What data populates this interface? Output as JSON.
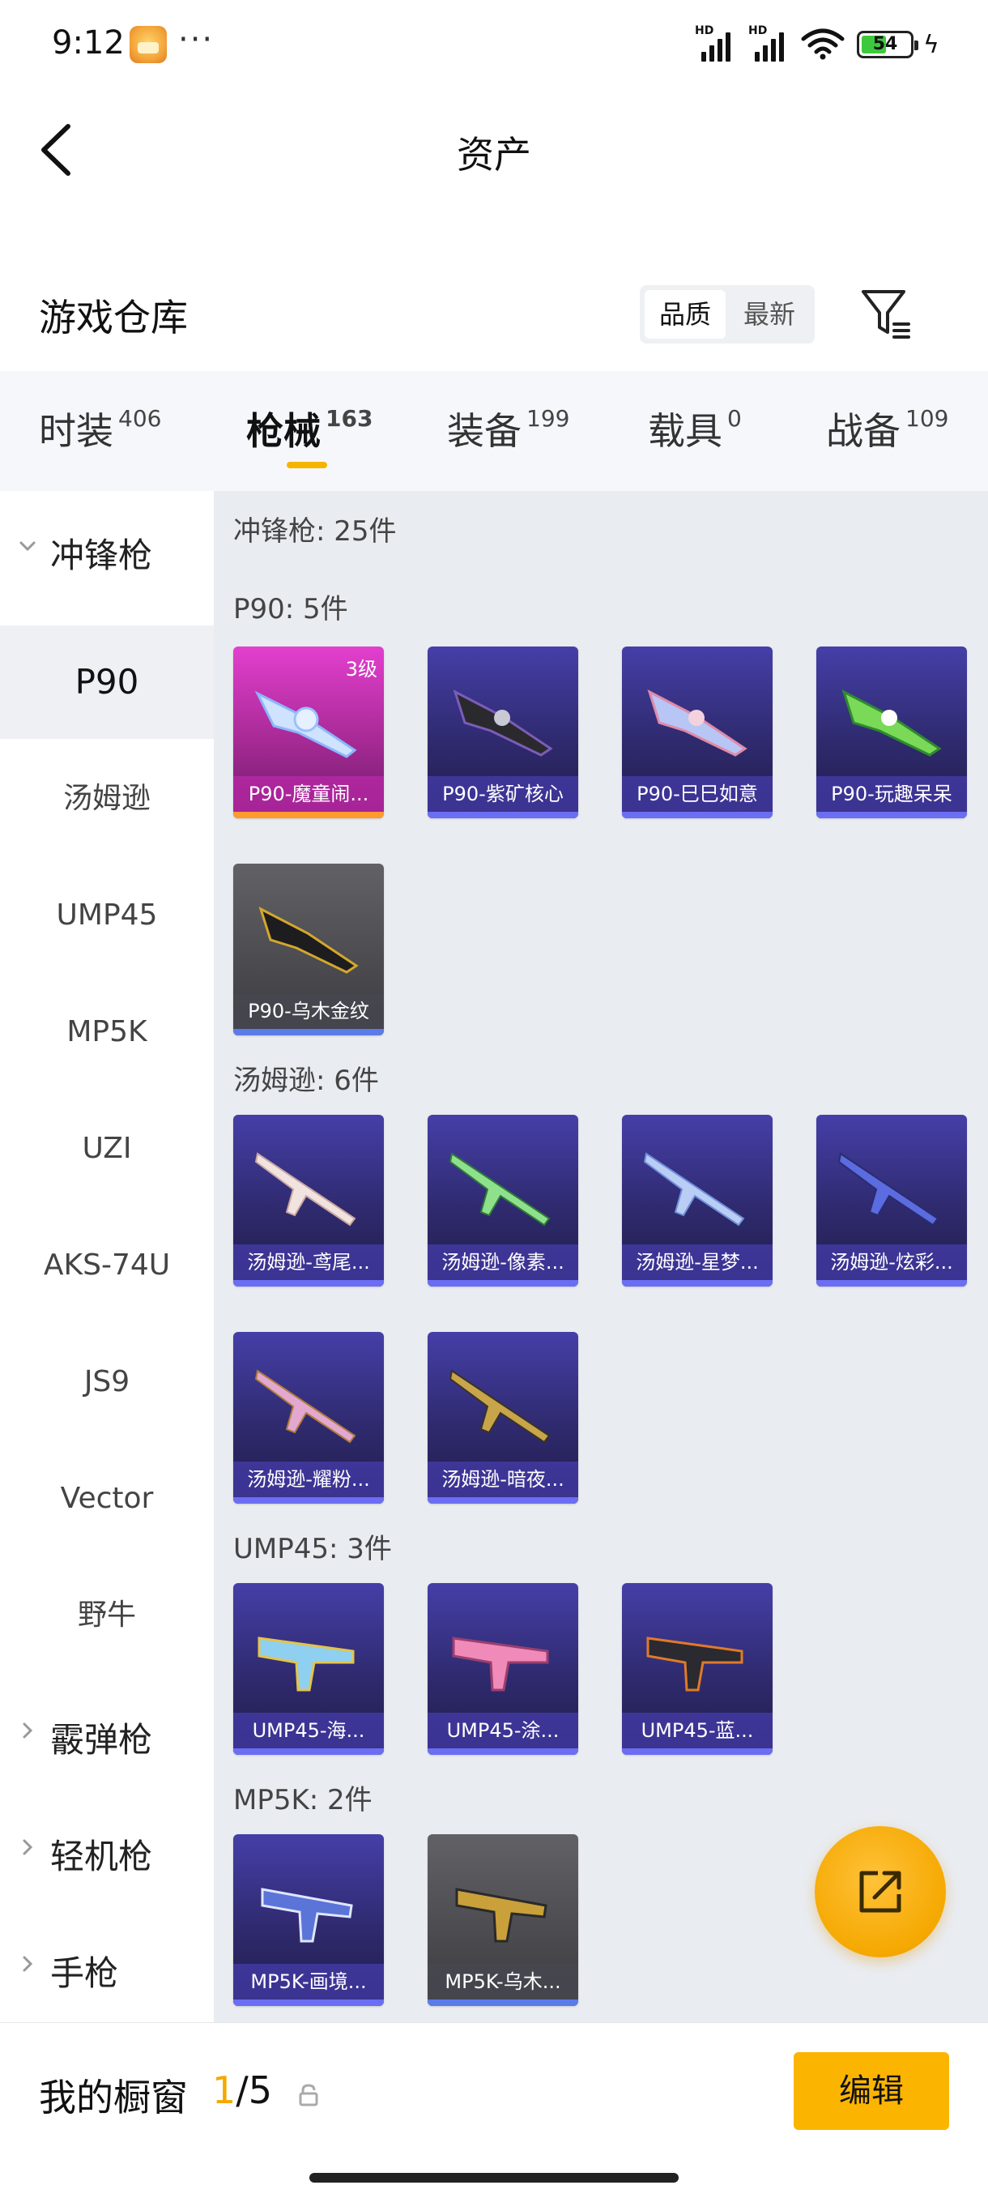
{
  "status_bar": {
    "time": "9:12",
    "dots": "···",
    "battery": "54",
    "hd1": "HD",
    "hd2": "HD"
  },
  "header": {
    "title": "资产"
  },
  "section": {
    "title": "游戏仓库",
    "sort_options": [
      "品质",
      "最新"
    ]
  },
  "tabs": [
    {
      "label": "时装",
      "count": "406"
    },
    {
      "label": "枪械",
      "count": "163"
    },
    {
      "label": "装备",
      "count": "199"
    },
    {
      "label": "载具",
      "count": "0"
    },
    {
      "label": "战备",
      "count": "109"
    }
  ],
  "sidebar": {
    "groups": [
      {
        "label": "冲锋枪",
        "expanded": true
      },
      {
        "label": "霰弹枪",
        "expanded": false
      },
      {
        "label": "轻机枪",
        "expanded": false
      },
      {
        "label": "手枪",
        "expanded": false
      }
    ],
    "items": [
      "P90",
      "汤姆逊",
      "UMP45",
      "MP5K",
      "UZI",
      "AKS-74U",
      "JS9",
      "Vector",
      "野牛"
    ],
    "active_item": "P90"
  },
  "content": {
    "category_title": "冲锋枪: 25件",
    "groups": [
      {
        "title": "P90: 5件",
        "items": [
          {
            "name": "P90-魔童闹...",
            "level": "3级",
            "rarity": "gold"
          },
          {
            "name": "P90-紫矿核心",
            "rarity": "purple"
          },
          {
            "name": "P90-巳巳如意",
            "rarity": "purple"
          },
          {
            "name": "P90-玩趣呆呆",
            "rarity": "purple"
          },
          {
            "name": "P90-乌木金纹",
            "rarity": "gray"
          }
        ]
      },
      {
        "title": "汤姆逊: 6件",
        "items": [
          {
            "name": "汤姆逊-鸢尾...",
            "rarity": "purple"
          },
          {
            "name": "汤姆逊-像素...",
            "rarity": "purple"
          },
          {
            "name": "汤姆逊-星梦...",
            "rarity": "purple"
          },
          {
            "name": "汤姆逊-炫彩...",
            "rarity": "purple"
          },
          {
            "name": "汤姆逊-耀粉...",
            "rarity": "purple"
          },
          {
            "name": "汤姆逊-暗夜...",
            "rarity": "purple"
          }
        ]
      },
      {
        "title": "UMP45: 3件",
        "items": [
          {
            "name": "UMP45-海...",
            "rarity": "purple"
          },
          {
            "name": "UMP45-涂...",
            "rarity": "purple"
          },
          {
            "name": "UMP45-蓝...",
            "rarity": "purple"
          }
        ]
      },
      {
        "title": "MP5K: 2件",
        "items": [
          {
            "name": "MP5K-画境...",
            "rarity": "purple"
          },
          {
            "name": "MP5K-乌木...",
            "rarity": "gray"
          }
        ]
      }
    ]
  },
  "bottom_bar": {
    "label": "我的橱窗",
    "current": "1",
    "total": "/5",
    "edit_label": "编辑"
  },
  "colors": {
    "accent": "#f5b400",
    "card_purple": "#3a3590",
    "card_gold": "#c030b0",
    "card_gray": "#4d4d52",
    "content_bg": "#e9ecf1"
  }
}
